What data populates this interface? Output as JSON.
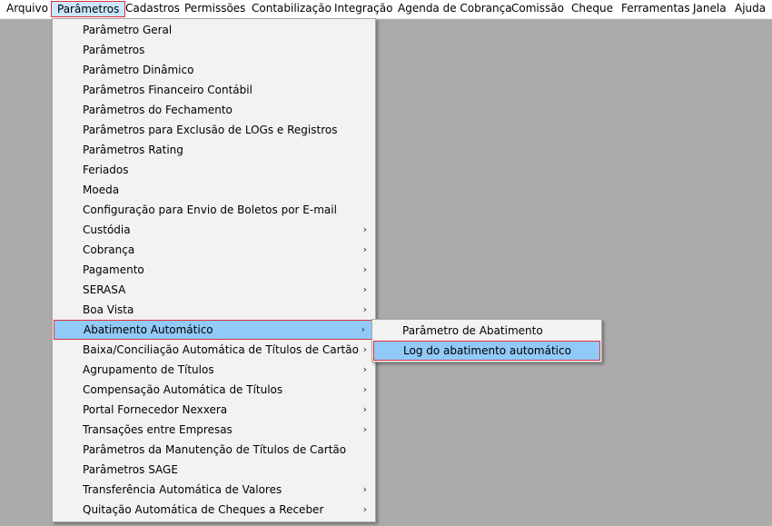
{
  "menubar": {
    "items": [
      "Arquivo",
      "Parâmetros",
      "Cadastros",
      "Permissões",
      "Contabilização",
      "Integração",
      "Agenda de Cobrança",
      "Comissão",
      "Cheque",
      "Ferramentas",
      "Janela",
      "Ajuda"
    ]
  },
  "parametros_menu": {
    "items": [
      {
        "label": "Parâmetro Geral"
      },
      {
        "label": "Parâmetros"
      },
      {
        "label": "Parâmetro Dinâmico"
      },
      {
        "label": "Parâmetros Financeiro Contábil"
      },
      {
        "label": "Parâmetros do Fechamento"
      },
      {
        "label": "Parâmetros para Exclusão de LOGs e Registros"
      },
      {
        "label": "Parâmetros Rating"
      },
      {
        "label": "Feriados"
      },
      {
        "label": "Moeda"
      },
      {
        "label": "Configuração para Envio de Boletos por E-mail"
      },
      {
        "label": "Custódia"
      },
      {
        "label": "Cobrança"
      },
      {
        "label": "Pagamento"
      },
      {
        "label": "SERASA"
      },
      {
        "label": "Boa Vista"
      },
      {
        "label": "Abatimento Automático"
      },
      {
        "label": "Baixa/Conciliação Automática de Títulos de Cartão"
      },
      {
        "label": "Agrupamento de Títulos"
      },
      {
        "label": "Compensação Automática de Títulos"
      },
      {
        "label": "Portal Fornecedor Nexxera"
      },
      {
        "label": "Transações entre Empresas"
      },
      {
        "label": "Parâmetros da Manutenção de Títulos de Cartão"
      },
      {
        "label": "Parâmetros SAGE"
      },
      {
        "label": "Transferência Automática de Valores"
      },
      {
        "label": "Quitação Automática de Cheques a Receber"
      }
    ]
  },
  "abatimento_submenu": {
    "items": [
      {
        "label": "Parâmetro de Abatimento"
      },
      {
        "label": "Log do abatimento automático"
      }
    ]
  },
  "icons": {
    "submenu_arrow": "›"
  }
}
